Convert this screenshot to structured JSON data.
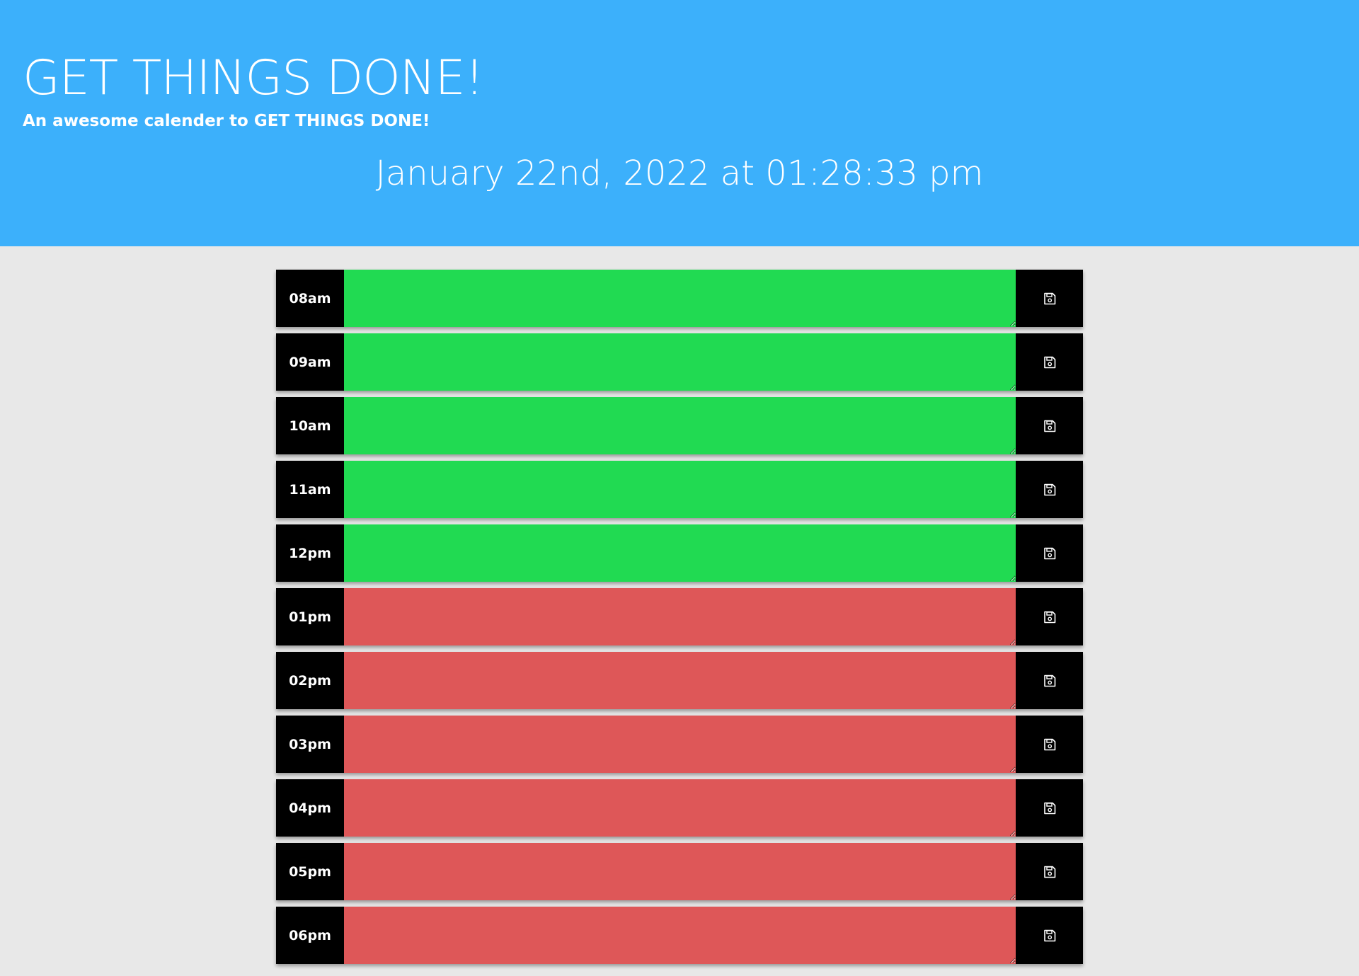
{
  "header": {
    "title": "GET THINGS DONE!",
    "subtitle": "An awesome calender to GET THINGS DONE!",
    "current_datetime": "January 22nd, 2022 at 01:28:33 pm"
  },
  "colors": {
    "header_background": "#3cb0fb",
    "future_slot": "#21da52",
    "past_slot": "#de5758",
    "hour_label_background": "#000000"
  },
  "save_icon": "floppy-disk-icon",
  "hours": [
    {
      "label": "08am",
      "status": "present-or-future",
      "task": ""
    },
    {
      "label": "09am",
      "status": "present-or-future",
      "task": ""
    },
    {
      "label": "10am",
      "status": "present-or-future",
      "task": ""
    },
    {
      "label": "11am",
      "status": "present-or-future",
      "task": ""
    },
    {
      "label": "12pm",
      "status": "present-or-future",
      "task": ""
    },
    {
      "label": "01pm",
      "status": "past",
      "task": ""
    },
    {
      "label": "02pm",
      "status": "past",
      "task": ""
    },
    {
      "label": "03pm",
      "status": "past",
      "task": ""
    },
    {
      "label": "04pm",
      "status": "past",
      "task": ""
    },
    {
      "label": "05pm",
      "status": "past",
      "task": ""
    },
    {
      "label": "06pm",
      "status": "past",
      "task": ""
    }
  ]
}
